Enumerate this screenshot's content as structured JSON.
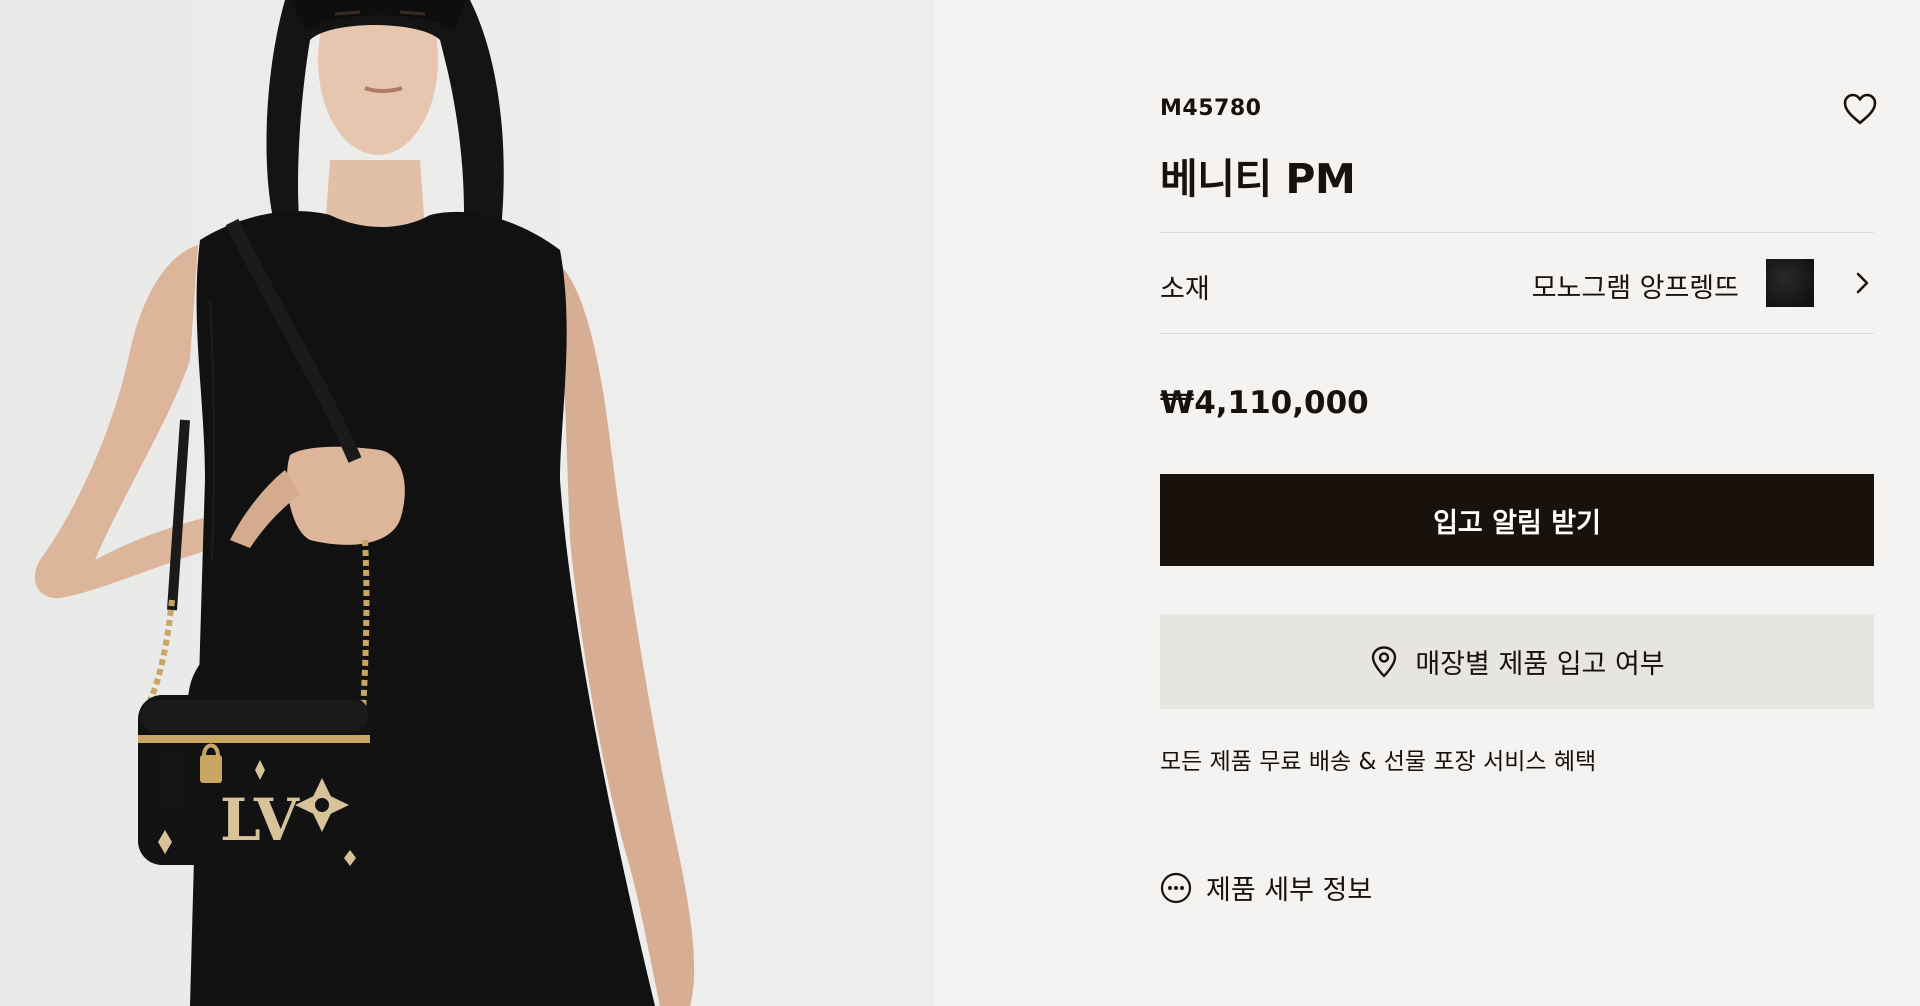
{
  "product": {
    "sku": "M45780",
    "title": "베니티 PM",
    "price": "₩4,110,000"
  },
  "material": {
    "label": "소재",
    "value": "모노그램 앙프렝뜨",
    "swatch_color": "#141414"
  },
  "actions": {
    "notify_label": "입고 알림 받기",
    "store_availability_label": "매장별 제품 입고 여부"
  },
  "shipping_note": "모든 제품 무료 배송 & 선물 포장 서비스 혜택",
  "details_link_label": "제품 세부 정보",
  "colors": {
    "primary_button": "#19110b",
    "secondary_button": "#e7e5e1",
    "background": "#f4f3f1",
    "photo_background": "#ececeb"
  },
  "icons": {
    "wishlist": "heart-icon",
    "material_next": "chevron-right-icon",
    "store": "location-pin-icon",
    "details": "more-dots-icon"
  }
}
